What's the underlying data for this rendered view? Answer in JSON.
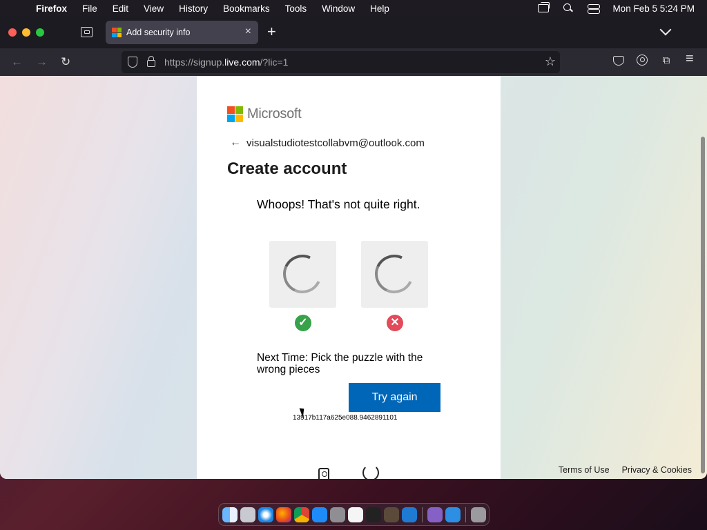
{
  "menubar": {
    "app_name": "Firefox",
    "items": [
      "File",
      "Edit",
      "View",
      "History",
      "Bookmarks",
      "Tools",
      "Window",
      "Help"
    ],
    "clock": "Mon Feb 5  5:24 PM"
  },
  "browser": {
    "tab": {
      "title": "Add security info"
    },
    "url": {
      "prefix": "https://signup.",
      "domain": "live.com",
      "suffix": "/?lic=1"
    }
  },
  "page": {
    "brand": "Microsoft",
    "identity_email": "visualstudiotestcollabvm@outlook.com",
    "title": "Create account",
    "challenge": {
      "message": "Whoops! That's not quite right.",
      "hint": "Next Time: Pick the puzzle with the wrong pieces",
      "button": "Try again",
      "session_id": "13917b117a625e088.9462891101"
    },
    "footer": {
      "terms": "Terms of Use",
      "privacy": "Privacy & Cookies"
    }
  },
  "colors": {
    "ms_red": "#f25022",
    "ms_green": "#7fba00",
    "ms_blue": "#00a4ef",
    "ms_yellow": "#ffb900",
    "primary_button": "#0067b8",
    "ok": "#37a24a",
    "error": "#e34a5a"
  },
  "dock": {
    "apps": [
      "finder-icon",
      "launchpad-icon",
      "safari-icon",
      "firefox-icon",
      "chrome-icon",
      "app-store-icon",
      "system-settings-icon",
      "textedit-icon",
      "terminal-icon",
      "script-editor-icon",
      "vscode-icon",
      "visual-studio-icon",
      "cloud-app-icon",
      "trash-icon"
    ]
  }
}
